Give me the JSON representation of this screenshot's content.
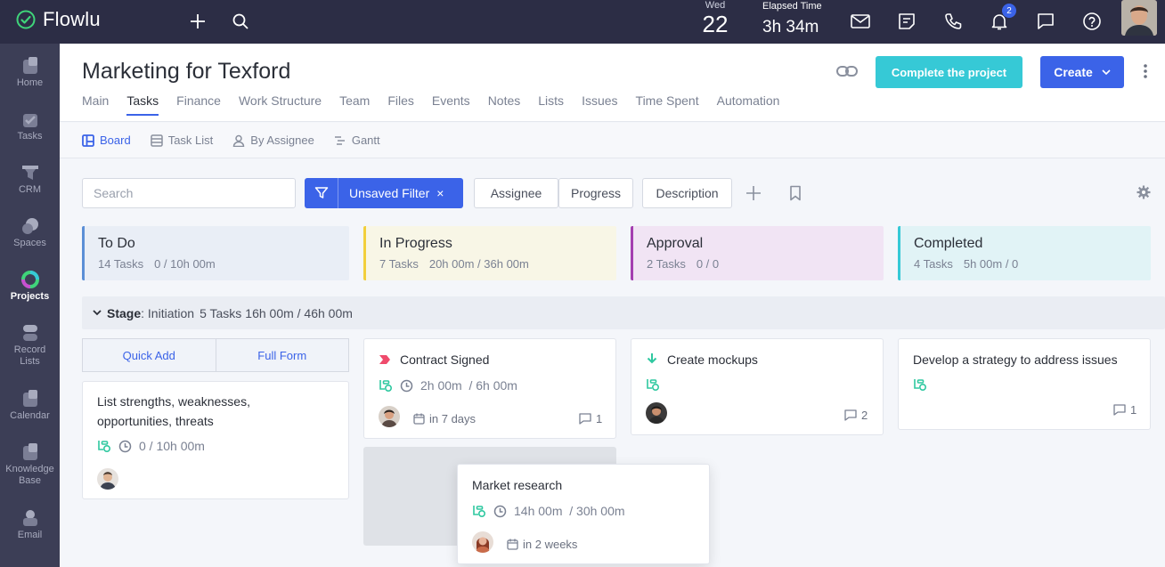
{
  "app": {
    "name": "Flowlu"
  },
  "topbar": {
    "date_weekday": "Wed",
    "date_day": "22",
    "elapsed_label": "Elapsed Time",
    "elapsed_value": "3h 34m",
    "notifications_count": "2"
  },
  "sidebar": {
    "items": [
      {
        "label": "Home"
      },
      {
        "label": "Tasks"
      },
      {
        "label": "CRM"
      },
      {
        "label": "Spaces"
      },
      {
        "label": "Projects"
      },
      {
        "label": "Record Lists"
      },
      {
        "label": "Calendar"
      },
      {
        "label": "Knowledge Base"
      },
      {
        "label": "Email"
      }
    ]
  },
  "header": {
    "title": "Marketing for Texford",
    "complete_label": "Complete the project",
    "create_label": "Create",
    "tabs": [
      {
        "label": "Main"
      },
      {
        "label": "Tasks"
      },
      {
        "label": "Finance"
      },
      {
        "label": "Work Structure"
      },
      {
        "label": "Team"
      },
      {
        "label": "Files"
      },
      {
        "label": "Events"
      },
      {
        "label": "Notes"
      },
      {
        "label": "Lists"
      },
      {
        "label": "Issues"
      },
      {
        "label": "Time Spent"
      },
      {
        "label": "Automation"
      }
    ]
  },
  "subnav": {
    "items": [
      {
        "label": "Board"
      },
      {
        "label": "Task List"
      },
      {
        "label": "By Assignee"
      },
      {
        "label": "Gantt"
      }
    ]
  },
  "toolbar": {
    "search_placeholder": "Search",
    "filter_label": "Unsaved Filter",
    "filter_close": "×",
    "buttons": [
      {
        "label": "Assignee"
      },
      {
        "label": "Progress"
      },
      {
        "label": "Description"
      }
    ]
  },
  "columns": [
    {
      "title": "To Do",
      "tasks": "14 Tasks",
      "time": "0 / 10h 00m",
      "accent": "#5b8fd6",
      "bg": "#e9eef6"
    },
    {
      "title": "In Progress",
      "tasks": "7 Tasks",
      "time": "20h 00m / 36h 00m",
      "accent": "#f2cf3c",
      "bg": "#f8f6e6"
    },
    {
      "title": "Approval",
      "tasks": "2 Tasks",
      "time": "0 / 0",
      "accent": "#a43fb0",
      "bg": "#f1e4f4"
    },
    {
      "title": "Completed",
      "tasks": "4 Tasks",
      "time": "5h 00m / 0",
      "accent": "#36c9d6",
      "bg": "#e1f3f6"
    }
  ],
  "stage": {
    "label": "Stage",
    "name": ": Initiation",
    "tasks": "5 Tasks",
    "time": "16h 00m / 46h 00m"
  },
  "quick_add": {
    "quick": "Quick Add",
    "full": "Full Form"
  },
  "cards": {
    "todo1": {
      "title": "List strengths, weaknesses, opportunities, threats",
      "time": "0 / 10h 00m"
    },
    "inprog1": {
      "title": "Contract Signed",
      "time": "2h 00m  / 6h 00m",
      "due": "in 7 days",
      "comments": "1"
    },
    "approval1": {
      "title": "Create mockups",
      "comments": "2"
    },
    "completed1": {
      "title": "Develop a strategy to address issues",
      "comments": "1"
    },
    "drag1": {
      "title": "Market research",
      "time": "14h 00m  / 30h 00m",
      "due": "in 2 weeks"
    }
  },
  "colors": {
    "brand": "#3b63e8",
    "teal": "#36c9d6",
    "topbar": "#2c2d45",
    "sidebar": "#3c3e56"
  }
}
